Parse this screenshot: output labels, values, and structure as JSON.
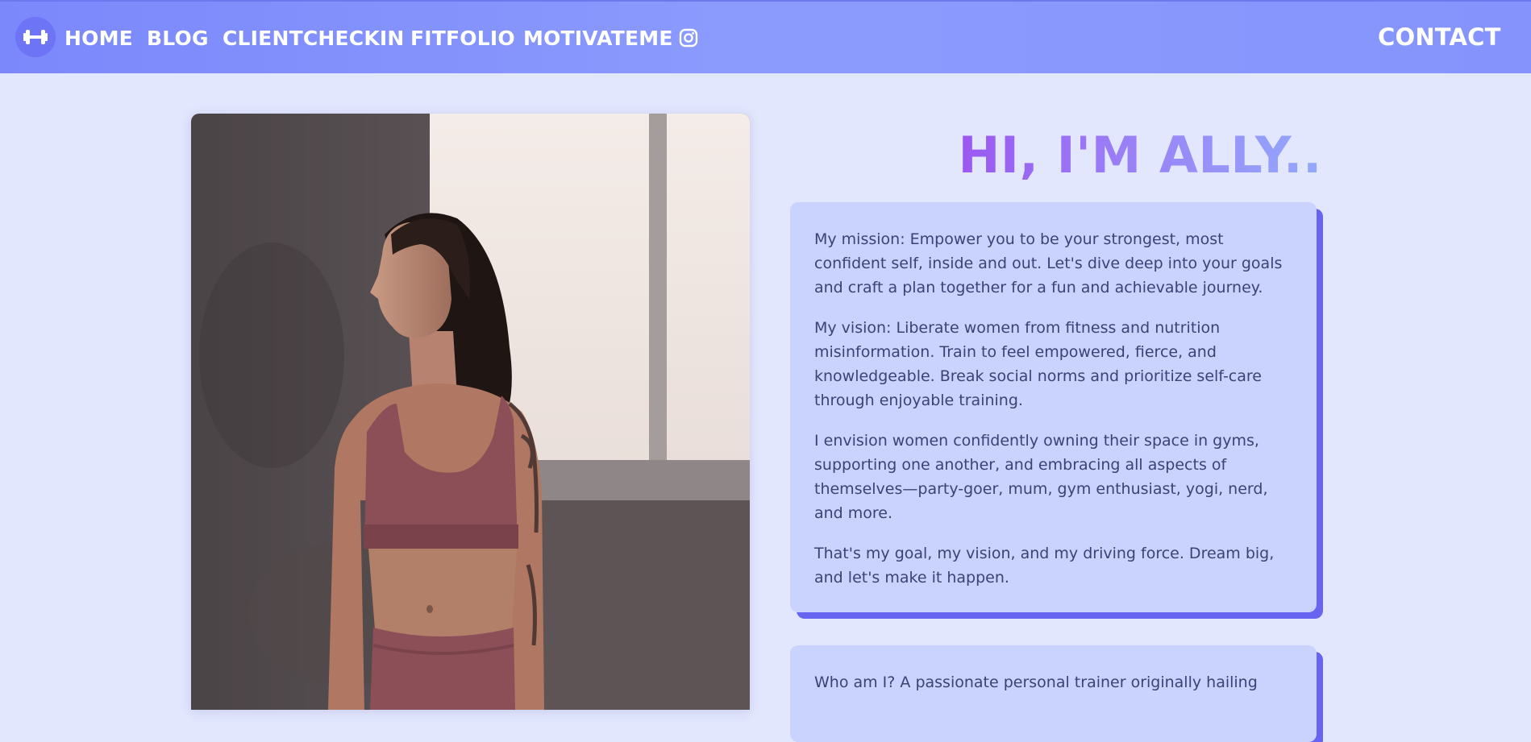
{
  "nav": {
    "logo_icon": "dumbbell-icon",
    "links": [
      "HOME",
      "BLOG",
      "CLIENTCHECKIN",
      "FITFOLIO",
      "MOTIVATEME"
    ],
    "social_icon": "instagram-icon",
    "contact": "CONTACT"
  },
  "hero": {
    "title": "HI, I'M ALLY..",
    "photo_alt": "woman-in-sportswear-photo"
  },
  "mission_card": {
    "paragraphs": [
      "My mission: Empower you to be your strongest, most confident self, inside and out. Let's dive deep into your goals and craft a plan together for a fun and achievable journey.",
      "My vision: Liberate women from fitness and nutrition misinformation. Train to feel empowered, fierce, and knowledgeable. Break social norms and prioritize self-care through enjoyable training.",
      "I envision women confidently owning their space in gyms, supporting one another, and embracing all aspects of themselves—party-goer, mum, gym enthusiast, yogi, nerd, and more.",
      "That's my goal, my vision, and my driving force. Dream big, and let's make it happen."
    ]
  },
  "about_card": {
    "paragraphs": [
      "Who am I? A passionate personal trainer originally hailing"
    ]
  },
  "colors": {
    "nav_bg": "#8494fc",
    "page_bg": "#e2e7fe",
    "card_bg": "#c9d3fe",
    "card_shadow": "#6664f0",
    "text": "#3d4275"
  }
}
